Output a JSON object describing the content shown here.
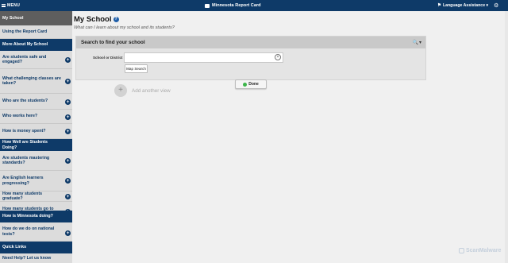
{
  "topbar": {
    "menu_label": "MENU",
    "brand_title": "Minnesota Report Card",
    "language_label": "Language Assistance ▾",
    "icons": {
      "menu": "hamburger-icon",
      "language": "flag-icon",
      "settings": "gear-icon"
    }
  },
  "sidebar": {
    "my_school": "My School",
    "using": "Using the Report Card",
    "section_more": "More About My School",
    "safe": "Are students safe and engaged?",
    "classes": "What challenging classes are taken?",
    "students": "Who are the students?",
    "works": "Who works here?",
    "money": "How is money spent?",
    "section_well": "How Well are Students Doing?",
    "standards": "Are students mastering standards?",
    "english": "Are English learners progressing?",
    "graduate": "How many students graduate?",
    "college": "How many students go to college?",
    "section_mn": "How is Minnesota doing?",
    "national": "How do we do on national tests?",
    "quick_links": "Quick Links",
    "need_help": "Need Help? Let us know"
  },
  "main": {
    "title": "My School",
    "subtitle": "What can I learn about my school and its students?",
    "search_panel": {
      "title": "Search to find your school",
      "field_label": "School or District",
      "input_value": "",
      "map_search_label": "Map Search"
    },
    "done_label": "Done",
    "add_view_label": "Add another view"
  },
  "watermark": {
    "text": "ScanMalware"
  },
  "colors": {
    "navy": "#0e3a68",
    "sidebar_bg": "#dcdcdc",
    "active": "#5e5e5e",
    "done_green": "#3cb54a"
  }
}
